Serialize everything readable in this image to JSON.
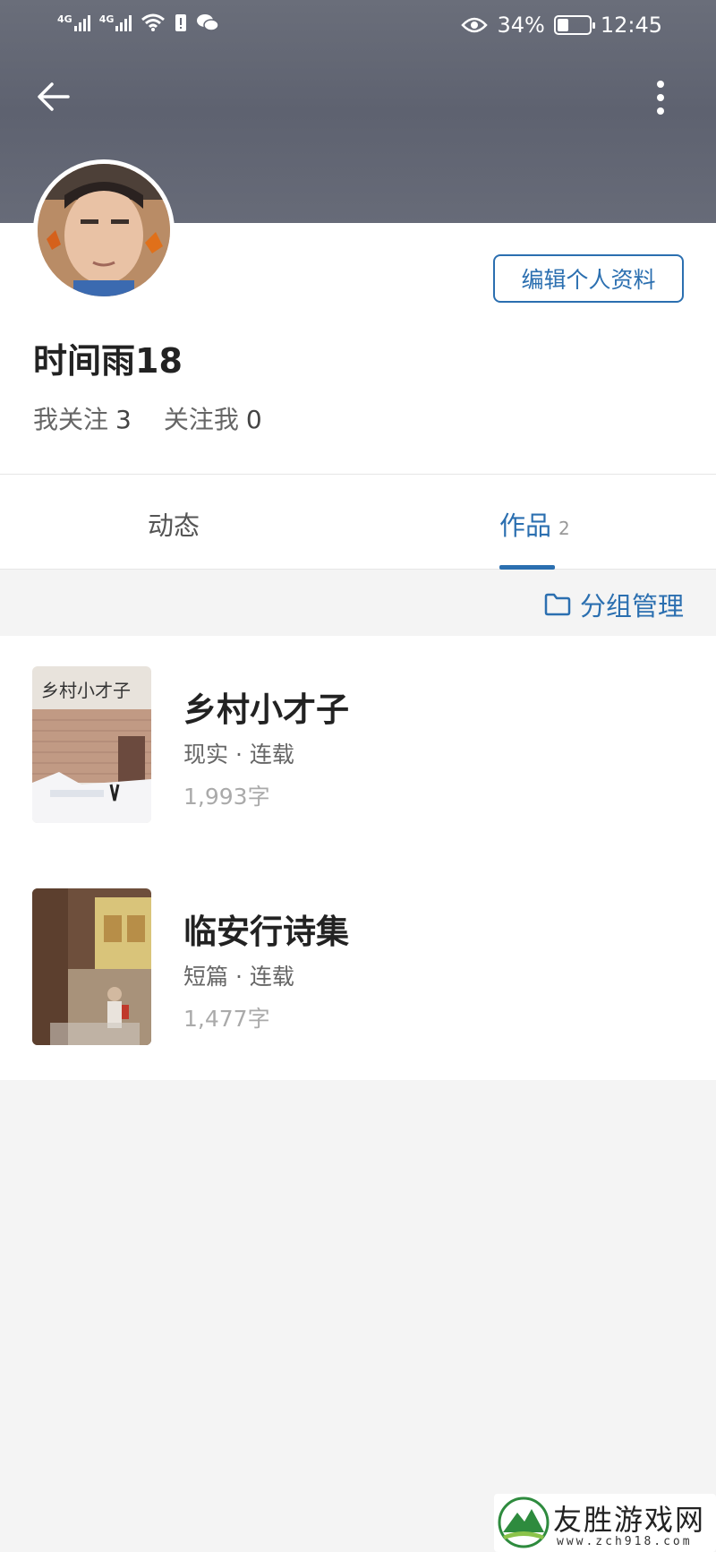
{
  "status_bar": {
    "signal1_label": "4G",
    "signal2_label": "4G",
    "battery_percent": "34%",
    "battery_level": 0.34,
    "time": "12:45"
  },
  "header": {
    "back_icon": "arrow-left-icon",
    "more_icon": "more-vertical-icon"
  },
  "profile": {
    "edit_label": "编辑个人资料",
    "username": "时间雨18",
    "following_label": "我关注",
    "following_count": "3",
    "followers_label": "关注我",
    "followers_count": "0"
  },
  "tabs": [
    {
      "label": "动态",
      "active": false
    },
    {
      "label": "作品",
      "count": "2",
      "active": true
    }
  ],
  "group_manage": {
    "icon": "folder-icon",
    "label": "分组管理"
  },
  "works": [
    {
      "title": "乡村小才子",
      "meta": "现实 · 连载",
      "words": "1,993字",
      "cover_title": "乡村小才子"
    },
    {
      "title": "临安行诗集",
      "meta": "短篇 · 连载",
      "words": "1,477字"
    }
  ],
  "watermark": {
    "text": "友胜游戏网",
    "url": "www.zch918.com"
  },
  "colors": {
    "accent": "#2b6fb0",
    "banner": "#646875"
  }
}
